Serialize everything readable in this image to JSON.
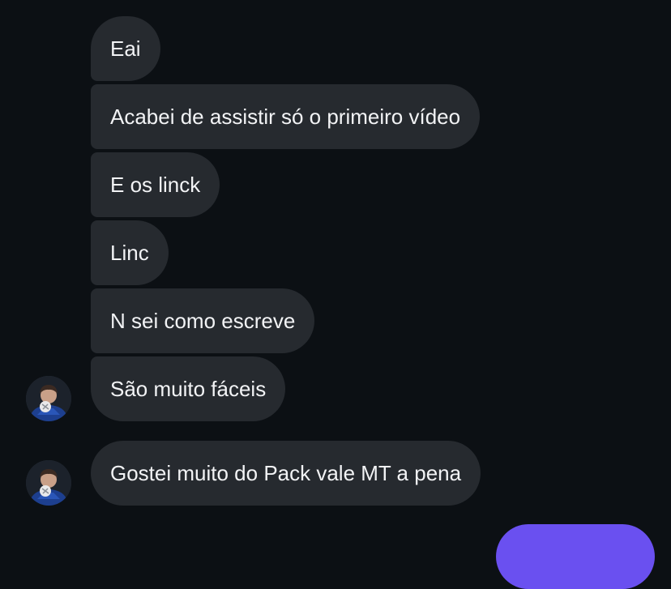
{
  "chat": {
    "messages": [
      {
        "text": "Eai"
      },
      {
        "text": "Acabei de assistir só o primeiro vídeo"
      },
      {
        "text": "E os linck"
      },
      {
        "text": "Linc"
      },
      {
        "text": "N sei como escreve"
      },
      {
        "text": "São muito fáceis"
      },
      {
        "text": "Gostei muito do Pack vale MT a pena"
      }
    ],
    "avatar": {
      "icon": "profile-photo-icon"
    },
    "colors": {
      "background": "#0c1014",
      "received_bubble": "#262a2f",
      "sent_bubble": "#6a50f0",
      "text": "#f2f3f5"
    }
  }
}
